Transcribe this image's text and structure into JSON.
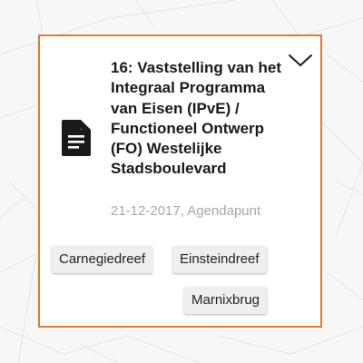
{
  "card": {
    "title": "16: Vaststelling van het Integraal Programma van Eisen (IPvE) / Functioneel Ontwerp (FO) Westelijke Stadsboulevard",
    "meta": "21-12-2017, Agendapunt",
    "icon": "document-icon",
    "toggle_icon": "chevron-down-icon",
    "border_color": "#e07a2e",
    "tags": [
      "Carnegiedreef",
      "Einsteindreef",
      "Marnixbrug"
    ]
  }
}
